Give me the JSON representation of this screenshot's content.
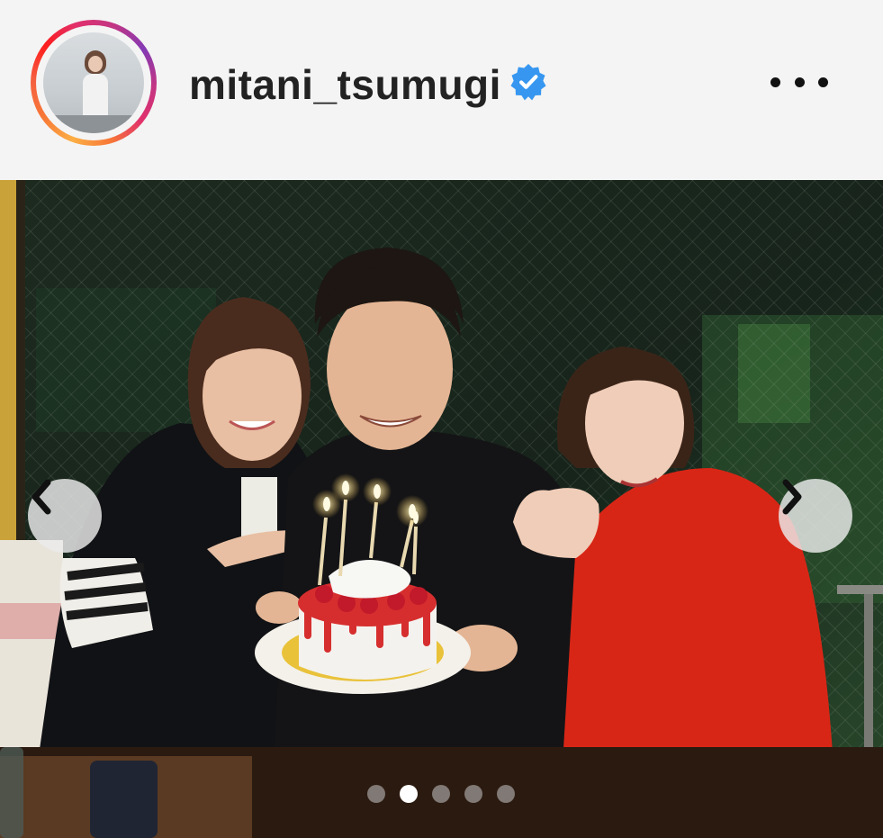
{
  "post": {
    "username": "mitani_tsumugi",
    "verified": true,
    "verified_badge_color": "#3797f0",
    "more_icon": "more-horizontal-icon",
    "avatar_ring_colors": [
      "#fcaf45",
      "#fd1d1d",
      "#c13584",
      "#833ab4"
    ]
  },
  "carousel": {
    "prev_icon": "chevron-left-icon",
    "next_icon": "chevron-right-icon",
    "slide_count": 5,
    "active_index": 1
  }
}
